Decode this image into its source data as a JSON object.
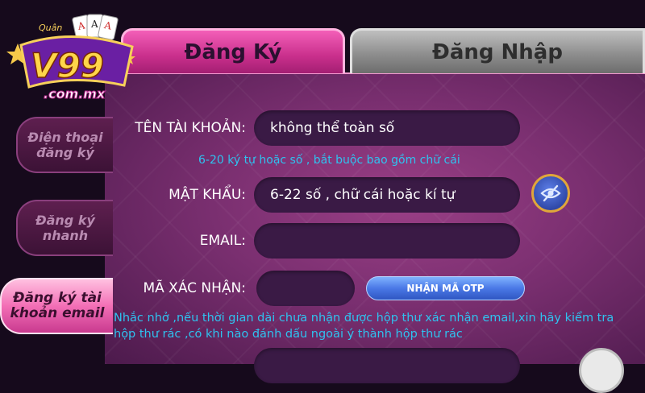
{
  "tabs": {
    "register": "Đăng Ký",
    "login": "Đăng Nhập"
  },
  "sidebar": {
    "items": [
      {
        "label": "Điện thoại đăng ký",
        "active": false
      },
      {
        "label": "Đăng ký nhanh",
        "active": false
      },
      {
        "label": "Đăng ký tài khoản email",
        "active": true
      }
    ]
  },
  "form": {
    "username_label": "TÊN TÀI KHOẢN:",
    "username_value": "không thể toàn số",
    "username_hint": "6-20 ký tự hoặc số , bắt buộc bao gồm chữ cái",
    "password_label": "MẬT KHẨU:",
    "password_placeholder": "6-22 số , chữ cái hoặc kí tự",
    "email_label": "EMAIL:",
    "email_value": "",
    "code_label": "MÃ XÁC NHẬN:",
    "code_value": "",
    "otp_button": "NHẬN MÃ OTP",
    "reminder": "Nhắc nhở ,nếu thời gian dài chưa nhận được hộp thư xác nhận email,xin hãy kiểm tra hộp thư rác ,có khi nào đánh dấu ngoài ý thành hộp thư rác"
  },
  "logo": {
    "brand": "V99",
    "domain": ".com.mx",
    "top_text": "Quân"
  },
  "icons": {
    "password_toggle": "eye-slash-icon",
    "bottom": "partial-round-icon"
  },
  "colors": {
    "accent_pink": "#e0439f",
    "hint_cyan": "#2fc2ef",
    "panel_purple": "#7a2f70",
    "otp_blue": "#4a78e6"
  }
}
